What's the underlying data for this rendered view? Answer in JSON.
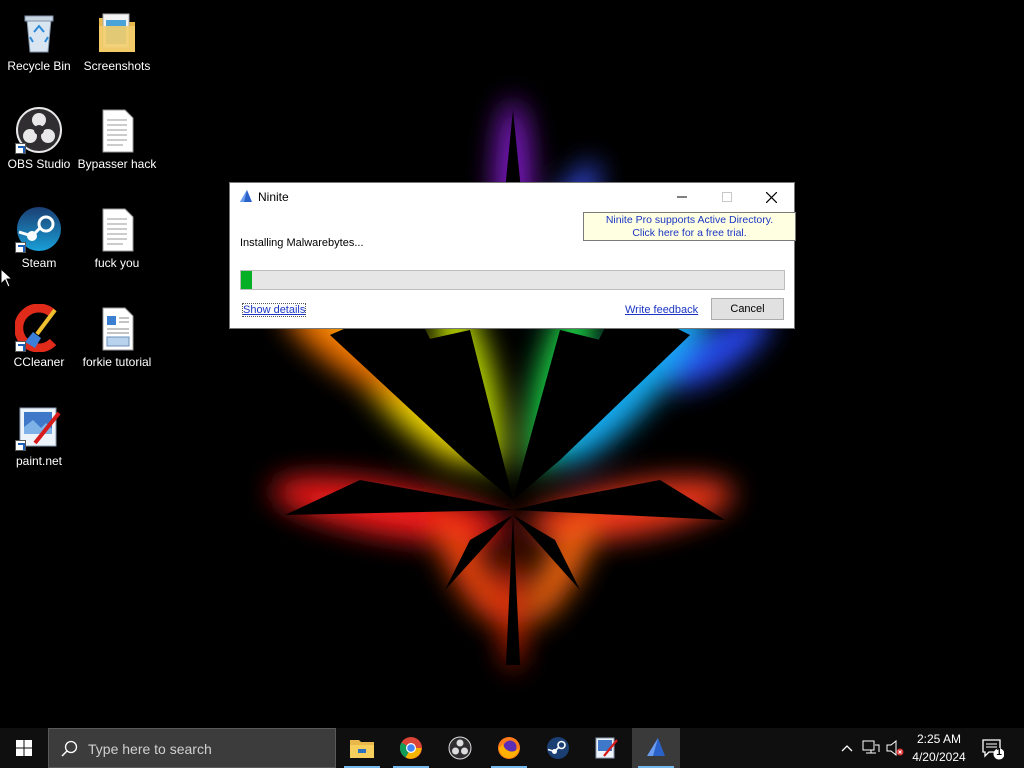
{
  "desktop": {
    "icons": [
      {
        "label": "Recycle Bin",
        "icon": "recycle-bin-icon"
      },
      {
        "label": "Screenshots",
        "icon": "folder-icon"
      },
      {
        "label": "OBS Studio",
        "icon": "obs-studio-icon"
      },
      {
        "label": "Bypasser hack",
        "icon": "text-file-icon"
      },
      {
        "label": "Steam",
        "icon": "steam-icon"
      },
      {
        "label": "fuck you",
        "icon": "text-file-icon"
      },
      {
        "label": "CCleaner",
        "icon": "ccleaner-icon"
      },
      {
        "label": "forkie tutorial",
        "icon": "document-icon"
      },
      {
        "label": "paint.net",
        "icon": "paint-net-icon"
      }
    ]
  },
  "ninite": {
    "title": "Ninite",
    "status": "Installing Malwarebytes...",
    "progress": 0.02,
    "promo_line1": "Ninite Pro supports Active Directory.",
    "promo_line2": "Click here for a free trial.",
    "show_details": "Show details",
    "write_feedback": "Write feedback",
    "cancel": "Cancel"
  },
  "taskbar": {
    "search_placeholder": "Type here to search",
    "apps": [
      {
        "name": "file-explorer",
        "running": true
      },
      {
        "name": "chrome",
        "running": true
      },
      {
        "name": "obs-studio",
        "running": false
      },
      {
        "name": "firefox",
        "running": true
      },
      {
        "name": "steam",
        "running": false
      },
      {
        "name": "paint-net",
        "running": false
      },
      {
        "name": "ninite",
        "running": true,
        "active": true
      }
    ],
    "time": "2:25 AM",
    "date": "4/20/2024",
    "notification_count": "1"
  },
  "colors": {
    "progress_fill": "#06b025",
    "link": "#1a35c4",
    "promo_bg": "#ffffe1",
    "taskbar_bg": "#0f0f0f"
  }
}
